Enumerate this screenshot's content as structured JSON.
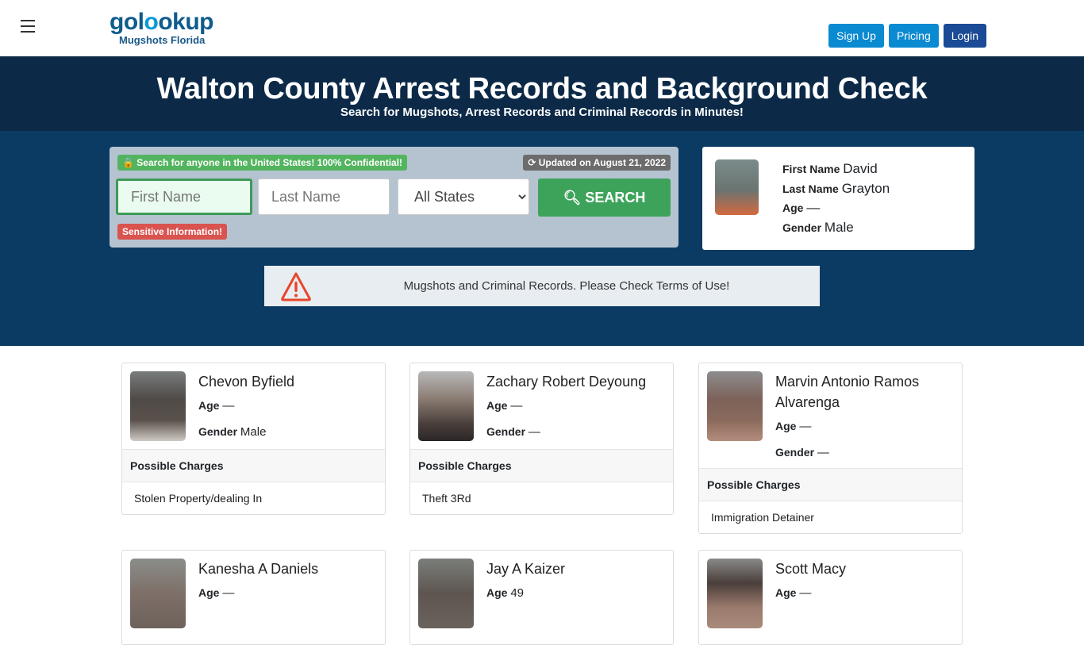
{
  "header": {
    "logo_main_pre": "gol",
    "logo_main_o": "o",
    "logo_main_post": "okup",
    "logo_sub": "Mugshots Florida",
    "menu_icon": "hamburger-icon",
    "buttons": [
      {
        "label": "Sign Up"
      },
      {
        "label": "Pricing"
      },
      {
        "label": "Login"
      }
    ]
  },
  "hero": {
    "title": "Walton County Arrest Records and Background Check",
    "subtitle": "Search for Mugshots, Arrest Records and Criminal Records in Minutes!"
  },
  "search": {
    "confidential_badge": "Search for anyone in the United States! 100% Confidential!",
    "updated_badge": "Updated on August 21, 2022",
    "first_name_placeholder": "First Name",
    "last_name_placeholder": "Last Name",
    "state_selected": "All States",
    "search_button": "SEARCH",
    "sensitive_badge": "Sensitive Information!"
  },
  "featured": {
    "first_name_label": "First Name",
    "first_name": "David",
    "last_name_label": "Last Name",
    "last_name": "Grayton",
    "age_label": "Age",
    "age": "—",
    "gender_label": "Gender",
    "gender": "Male"
  },
  "warning": {
    "text": "Mugshots and Criminal Records. Please Check Terms of Use!"
  },
  "labels": {
    "age": "Age",
    "gender": "Gender",
    "possible_charges": "Possible Charges"
  },
  "records": [
    {
      "name": "Chevon Byfield",
      "age": "—",
      "gender": "Male",
      "charge": "Stolen Property/dealing In"
    },
    {
      "name": "Zachary Robert Deyoung",
      "age": "—",
      "gender": "—",
      "charge": "Theft 3Rd"
    },
    {
      "name": "Marvin Antonio Ramos Alvarenga",
      "age": "—",
      "gender": "—",
      "charge": "Immigration Detainer"
    },
    {
      "name": "Kanesha A Daniels",
      "age": "—"
    },
    {
      "name": "Jay A Kaizer",
      "age": "49"
    },
    {
      "name": "Scott Macy",
      "age": "—"
    }
  ]
}
